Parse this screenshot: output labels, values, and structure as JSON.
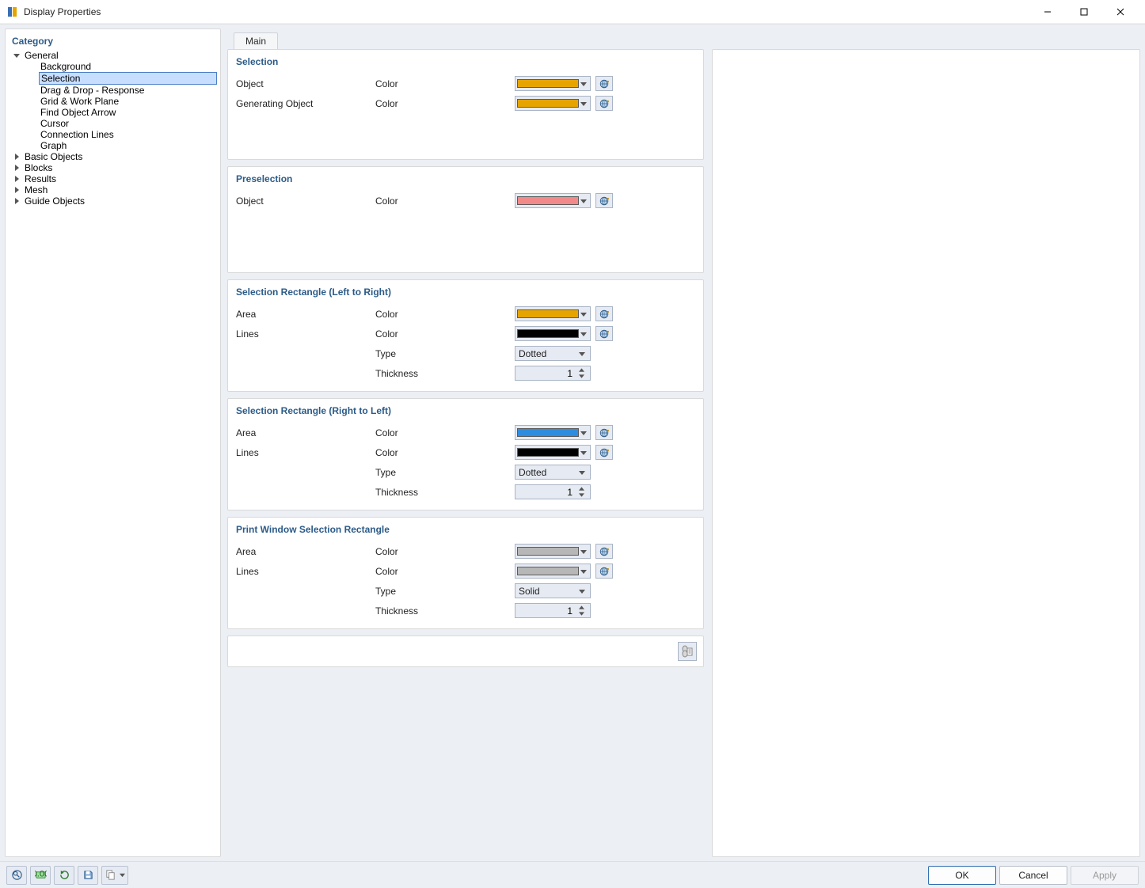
{
  "window": {
    "title": "Display Properties"
  },
  "sidebar": {
    "header": "Category",
    "general": {
      "label": "General",
      "children": [
        "Background",
        "Selection",
        "Drag & Drop - Response",
        "Grid & Work Plane",
        "Find Object Arrow",
        "Cursor",
        "Connection Lines",
        "Graph"
      ],
      "selectedIndex": 1
    },
    "topItems": [
      "Basic Objects",
      "Blocks",
      "Results",
      "Mesh",
      "Guide Objects"
    ]
  },
  "tabs": {
    "main": "Main"
  },
  "labels": {
    "color": "Color",
    "type": "Type",
    "thickness": "Thickness",
    "object": "Object",
    "generating_object": "Generating Object",
    "area": "Area",
    "lines": "Lines"
  },
  "colors": {
    "amber": "#e6a400",
    "salmon": "#f28a8a",
    "black": "#000000",
    "blue": "#2f8de0",
    "gray": "#b7b7b7"
  },
  "groups": {
    "selection": {
      "title": "Selection",
      "rows": [
        {
          "name_key": "object",
          "prop_key": "color",
          "swatch": "amber"
        },
        {
          "name_key": "generating_object",
          "prop_key": "color",
          "swatch": "amber"
        }
      ]
    },
    "preselection": {
      "title": "Preselection",
      "rows": [
        {
          "name_key": "object",
          "prop_key": "color",
          "swatch": "salmon"
        }
      ]
    },
    "sel_lr": {
      "title": "Selection Rectangle (Left to Right)",
      "rows": [
        {
          "name_key": "area",
          "prop_key": "color",
          "swatch": "amber"
        },
        {
          "name_key": "lines",
          "prop_key": "color",
          "swatch": "black"
        },
        {
          "name_key": "",
          "prop_key": "type",
          "combo": "Dotted"
        },
        {
          "name_key": "",
          "prop_key": "thickness",
          "spin": "1"
        }
      ]
    },
    "sel_rl": {
      "title": "Selection Rectangle (Right to Left)",
      "rows": [
        {
          "name_key": "area",
          "prop_key": "color",
          "swatch": "blue"
        },
        {
          "name_key": "lines",
          "prop_key": "color",
          "swatch": "black"
        },
        {
          "name_key": "",
          "prop_key": "type",
          "combo": "Dotted"
        },
        {
          "name_key": "",
          "prop_key": "thickness",
          "spin": "1"
        }
      ]
    },
    "print_rect": {
      "title": "Print Window Selection Rectangle",
      "rows": [
        {
          "name_key": "area",
          "prop_key": "color",
          "swatch": "gray"
        },
        {
          "name_key": "lines",
          "prop_key": "color",
          "swatch": "gray"
        },
        {
          "name_key": "",
          "prop_key": "type",
          "combo": "Solid"
        },
        {
          "name_key": "",
          "prop_key": "thickness",
          "spin": "1"
        }
      ]
    }
  },
  "footer": {
    "ok": "OK",
    "cancel": "Cancel",
    "apply": "Apply"
  }
}
